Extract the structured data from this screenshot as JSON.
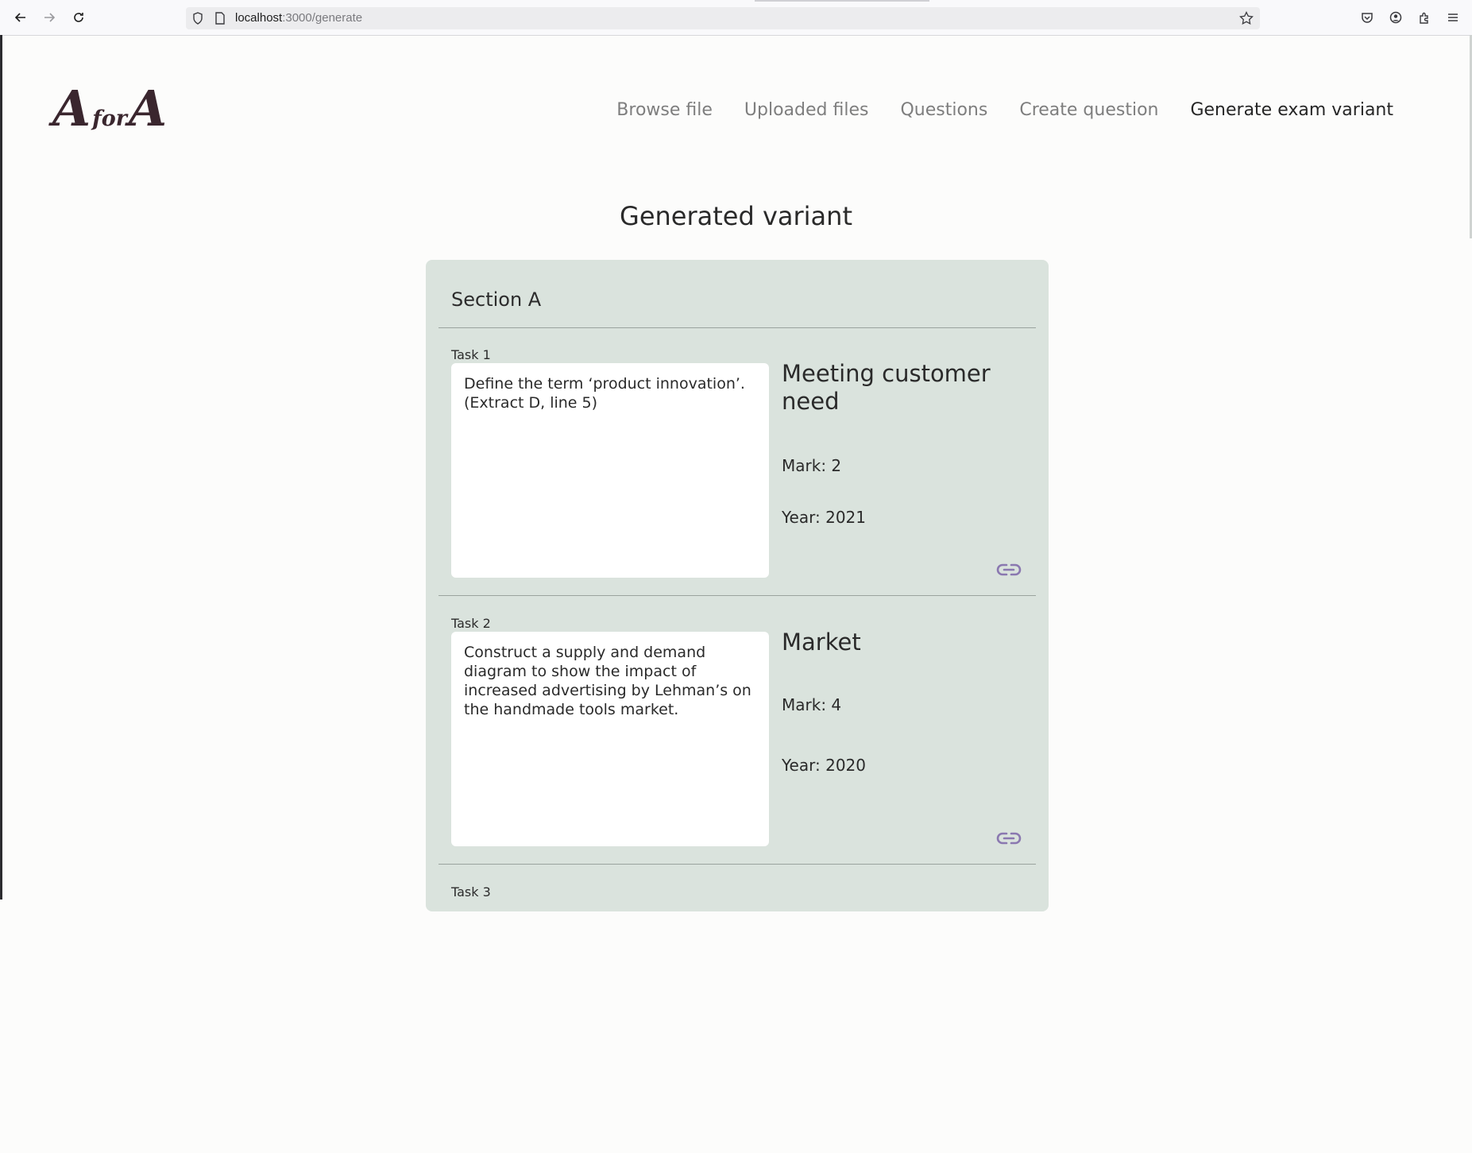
{
  "browser": {
    "url_host": "localhost",
    "url_path": ":3000/generate"
  },
  "site": {
    "logo_big_1": "A",
    "logo_small": "for",
    "logo_big_2": "A",
    "nav": [
      {
        "label": "Browse file",
        "active": false
      },
      {
        "label": "Uploaded files",
        "active": false
      },
      {
        "label": "Questions",
        "active": false
      },
      {
        "label": "Create question",
        "active": false
      },
      {
        "label": "Generate exam variant",
        "active": true
      }
    ]
  },
  "main": {
    "title": "Generated variant",
    "section": {
      "title": "Section A",
      "tasks": [
        {
          "label": "Task 1",
          "text": "Define the term ‘product innovation’. (Extract D, line 5)",
          "topic": "Meeting customer need",
          "mark": "Mark: 2",
          "year": "Year: 2021"
        },
        {
          "label": "Task 2",
          "text": "Construct a supply and demand diagram to show the impact of increased advertising by Lehman’s on the handmade tools market.",
          "topic": "Market",
          "mark": "Mark: 4",
          "year": "Year: 2020"
        },
        {
          "label": "Task 3"
        }
      ]
    }
  },
  "colors": {
    "card_bg": "#dae3dd",
    "link_icon": "#8a78b0",
    "active_nav": "#262626",
    "inactive_nav": "#7e7e7e"
  }
}
